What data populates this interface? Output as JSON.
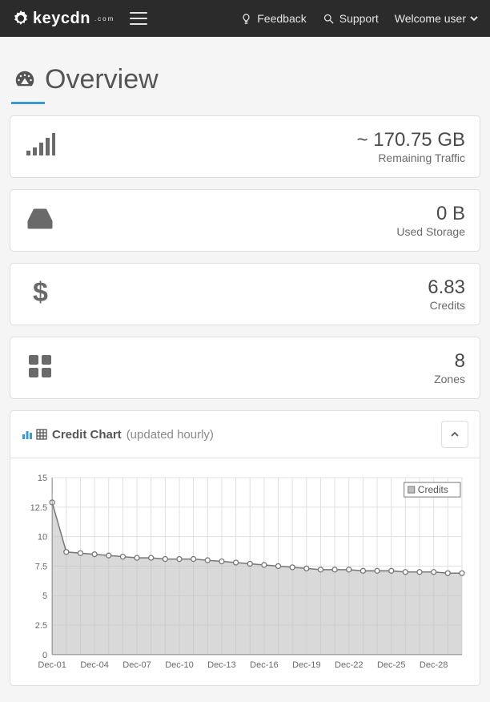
{
  "topbar": {
    "brand_name": "keycdn",
    "brand_sub": ".com",
    "feedback_label": "Feedback",
    "support_label": "Support",
    "user_label": "Welcome user"
  },
  "page": {
    "title": "Overview"
  },
  "stats": {
    "traffic": {
      "value": "~ 170.75 GB",
      "label": "Remaining Traffic"
    },
    "storage": {
      "value": "0 B",
      "label": "Used Storage"
    },
    "credits": {
      "value": "6.83",
      "label": "Credits"
    },
    "zones": {
      "value": "8",
      "label": "Zones"
    }
  },
  "chart_panel": {
    "title": "Credit Chart",
    "subtitle": "(updated hourly)",
    "legend_label": "Credits"
  },
  "chart_data": {
    "type": "area",
    "title": "Credit Chart",
    "xlabel": "",
    "ylabel": "",
    "ylim": [
      0,
      15
    ],
    "y_ticks": [
      0,
      2.5,
      5.0,
      7.5,
      10.0,
      12.5,
      15.0
    ],
    "x_tick_labels": [
      "Dec-01",
      "Dec-04",
      "Dec-07",
      "Dec-10",
      "Dec-13",
      "Dec-16",
      "Dec-19",
      "Dec-22",
      "Dec-25",
      "Dec-28"
    ],
    "categories": [
      "Dec-01",
      "Dec-02",
      "Dec-03",
      "Dec-04",
      "Dec-05",
      "Dec-06",
      "Dec-07",
      "Dec-08",
      "Dec-09",
      "Dec-10",
      "Dec-11",
      "Dec-12",
      "Dec-13",
      "Dec-14",
      "Dec-15",
      "Dec-16",
      "Dec-17",
      "Dec-18",
      "Dec-19",
      "Dec-20",
      "Dec-21",
      "Dec-22",
      "Dec-23",
      "Dec-24",
      "Dec-25",
      "Dec-26",
      "Dec-27",
      "Dec-28",
      "Dec-29",
      "Dec-30"
    ],
    "series": [
      {
        "name": "Credits",
        "values": [
          12.9,
          8.7,
          8.6,
          8.5,
          8.4,
          8.3,
          8.2,
          8.2,
          8.1,
          8.1,
          8.1,
          8.0,
          7.9,
          7.8,
          7.7,
          7.6,
          7.5,
          7.4,
          7.3,
          7.2,
          7.2,
          7.2,
          7.1,
          7.1,
          7.1,
          7.0,
          7.0,
          7.0,
          6.9,
          6.9
        ]
      }
    ]
  }
}
